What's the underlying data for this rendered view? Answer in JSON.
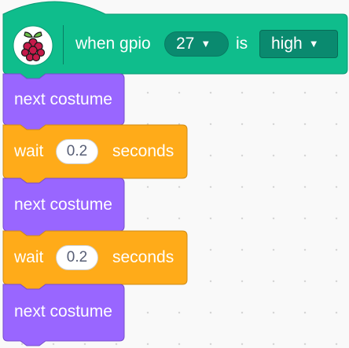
{
  "hat_block": {
    "prefix": "when gpio",
    "pin": {
      "value": "27"
    },
    "middle": "is",
    "level": {
      "value": "high"
    },
    "icon": "raspberry-pi-icon"
  },
  "stack": [
    {
      "type": "looks",
      "text": "next costume"
    },
    {
      "type": "wait",
      "prefix": "wait",
      "value": "0.2",
      "suffix": "seconds"
    },
    {
      "type": "looks",
      "text": "next costume"
    },
    {
      "type": "wait",
      "prefix": "wait",
      "value": "0.2",
      "suffix": "seconds"
    },
    {
      "type": "looks",
      "text": "next costume"
    }
  ],
  "colors": {
    "extension_green": "#0fbd8c",
    "extension_green_dark": "#0b9a74",
    "looks_purple": "#9966ff",
    "looks_purple_dark": "#774dcb",
    "control_orange": "#ffab19",
    "control_orange_dark": "#cf8b17"
  }
}
